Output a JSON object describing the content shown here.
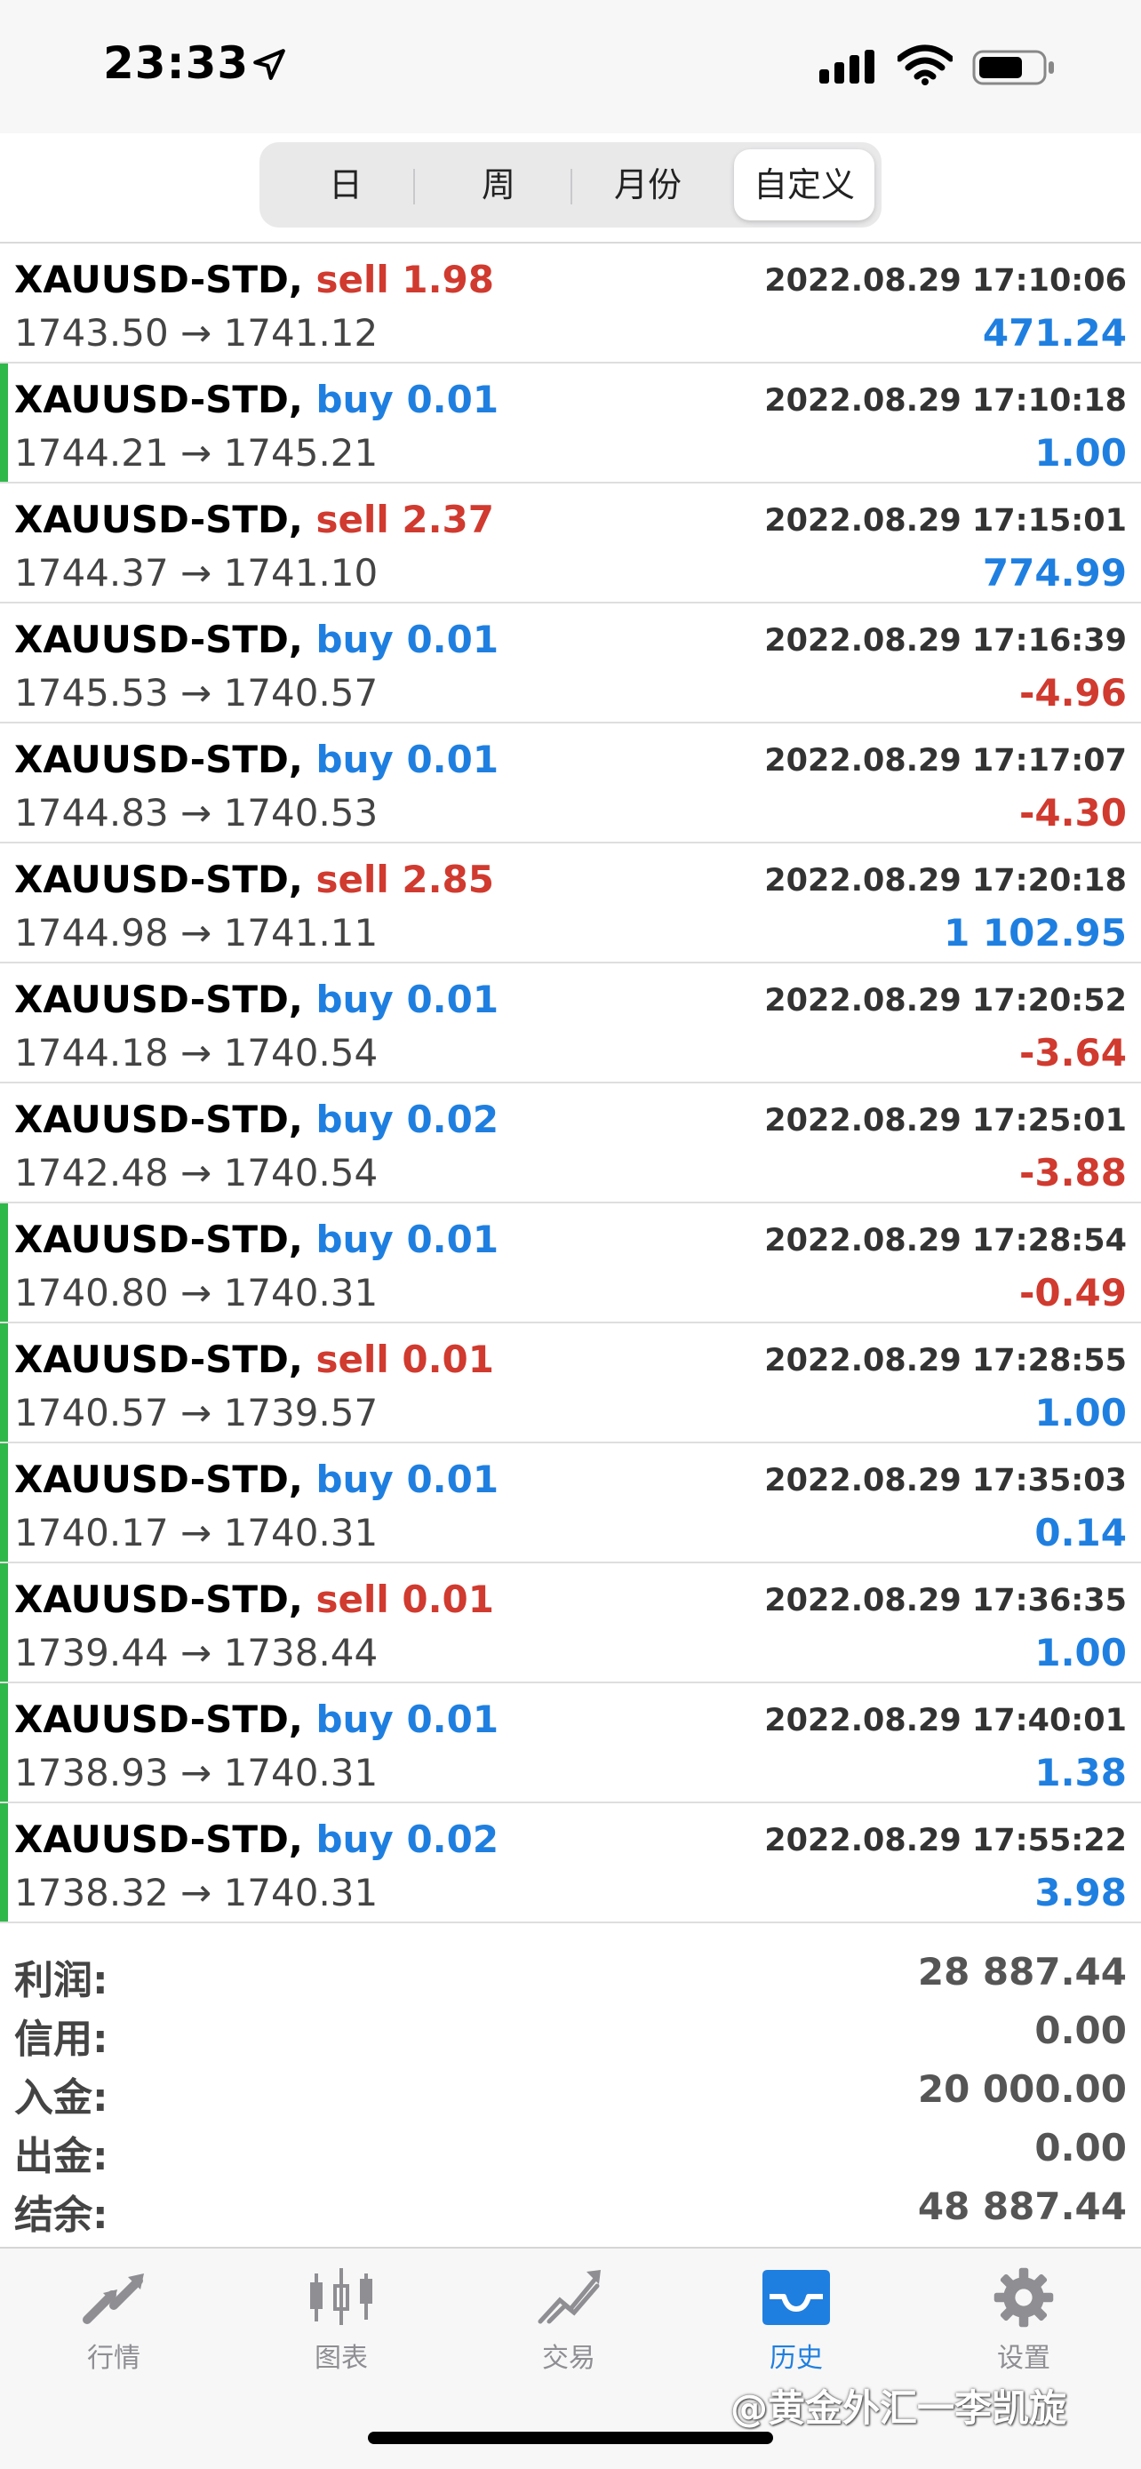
{
  "status_bar": {
    "time": "23:33"
  },
  "segments": [
    "日",
    "周",
    "月份",
    "自定义"
  ],
  "active_segment": "自定义",
  "deals": [
    {
      "symbol": "XAUUSD-STD,",
      "side": "sell",
      "volume": "1.98",
      "timestamp": "2022.08.29 17:10:06",
      "prices": "1743.50 → 1741.12",
      "profit": "471.24",
      "profit_sign": "pos",
      "accent": false
    },
    {
      "symbol": "XAUUSD-STD,",
      "side": "buy",
      "volume": "0.01",
      "timestamp": "2022.08.29 17:10:18",
      "prices": "1744.21 → 1745.21",
      "profit": "1.00",
      "profit_sign": "pos",
      "accent": true
    },
    {
      "symbol": "XAUUSD-STD,",
      "side": "sell",
      "volume": "2.37",
      "timestamp": "2022.08.29 17:15:01",
      "prices": "1744.37 → 1741.10",
      "profit": "774.99",
      "profit_sign": "pos",
      "accent": false
    },
    {
      "symbol": "XAUUSD-STD,",
      "side": "buy",
      "volume": "0.01",
      "timestamp": "2022.08.29 17:16:39",
      "prices": "1745.53 → 1740.57",
      "profit": "-4.96",
      "profit_sign": "neg",
      "accent": false
    },
    {
      "symbol": "XAUUSD-STD,",
      "side": "buy",
      "volume": "0.01",
      "timestamp": "2022.08.29 17:17:07",
      "prices": "1744.83 → 1740.53",
      "profit": "-4.30",
      "profit_sign": "neg",
      "accent": false
    },
    {
      "symbol": "XAUUSD-STD,",
      "side": "sell",
      "volume": "2.85",
      "timestamp": "2022.08.29 17:20:18",
      "prices": "1744.98 → 1741.11",
      "profit": "1 102.95",
      "profit_sign": "pos",
      "accent": false
    },
    {
      "symbol": "XAUUSD-STD,",
      "side": "buy",
      "volume": "0.01",
      "timestamp": "2022.08.29 17:20:52",
      "prices": "1744.18 → 1740.54",
      "profit": "-3.64",
      "profit_sign": "neg",
      "accent": false
    },
    {
      "symbol": "XAUUSD-STD,",
      "side": "buy",
      "volume": "0.02",
      "timestamp": "2022.08.29 17:25:01",
      "prices": "1742.48 → 1740.54",
      "profit": "-3.88",
      "profit_sign": "neg",
      "accent": false
    },
    {
      "symbol": "XAUUSD-STD,",
      "side": "buy",
      "volume": "0.01",
      "timestamp": "2022.08.29 17:28:54",
      "prices": "1740.80 → 1740.31",
      "profit": "-0.49",
      "profit_sign": "neg",
      "accent": true
    },
    {
      "symbol": "XAUUSD-STD,",
      "side": "sell",
      "volume": "0.01",
      "timestamp": "2022.08.29 17:28:55",
      "prices": "1740.57 → 1739.57",
      "profit": "1.00",
      "profit_sign": "pos",
      "accent": true
    },
    {
      "symbol": "XAUUSD-STD,",
      "side": "buy",
      "volume": "0.01",
      "timestamp": "2022.08.29 17:35:03",
      "prices": "1740.17 → 1740.31",
      "profit": "0.14",
      "profit_sign": "pos",
      "accent": true
    },
    {
      "symbol": "XAUUSD-STD,",
      "side": "sell",
      "volume": "0.01",
      "timestamp": "2022.08.29 17:36:35",
      "prices": "1739.44 → 1738.44",
      "profit": "1.00",
      "profit_sign": "pos",
      "accent": true
    },
    {
      "symbol": "XAUUSD-STD,",
      "side": "buy",
      "volume": "0.01",
      "timestamp": "2022.08.29 17:40:01",
      "prices": "1738.93 → 1740.31",
      "profit": "1.38",
      "profit_sign": "pos",
      "accent": true
    },
    {
      "symbol": "XAUUSD-STD,",
      "side": "buy",
      "volume": "0.02",
      "timestamp": "2022.08.29 17:55:22",
      "prices": "1738.32 → 1740.31",
      "profit": "3.98",
      "profit_sign": "pos",
      "accent": true
    }
  ],
  "summary": [
    {
      "label": "利润:",
      "value": "28 887.44"
    },
    {
      "label": "信用:",
      "value": "0.00"
    },
    {
      "label": "入金:",
      "value": "20 000.00"
    },
    {
      "label": "出金:",
      "value": "0.00"
    },
    {
      "label": "结余:",
      "value": "48 887.44"
    }
  ],
  "tabs": [
    {
      "label": "行情",
      "icon": "quotes-arrows-icon",
      "active": false
    },
    {
      "label": "图表",
      "icon": "candlestick-chart-icon",
      "active": false
    },
    {
      "label": "交易",
      "icon": "trade-trend-icon",
      "active": false
    },
    {
      "label": "历史",
      "icon": "history-tray-icon",
      "active": true
    },
    {
      "label": "设置",
      "icon": "gear-icon",
      "active": false
    }
  ],
  "watermark": "@黄金外汇一李凯旋",
  "colors": {
    "sell": "#d03a2f",
    "buy": "#1f7fe0",
    "positive_profit": "#1f7fe0",
    "negative_profit": "#d03a2f",
    "accent_bar": "#2fb84a",
    "active_tab": "#1f7fe0",
    "inactive_tab": "#8e8e93"
  }
}
